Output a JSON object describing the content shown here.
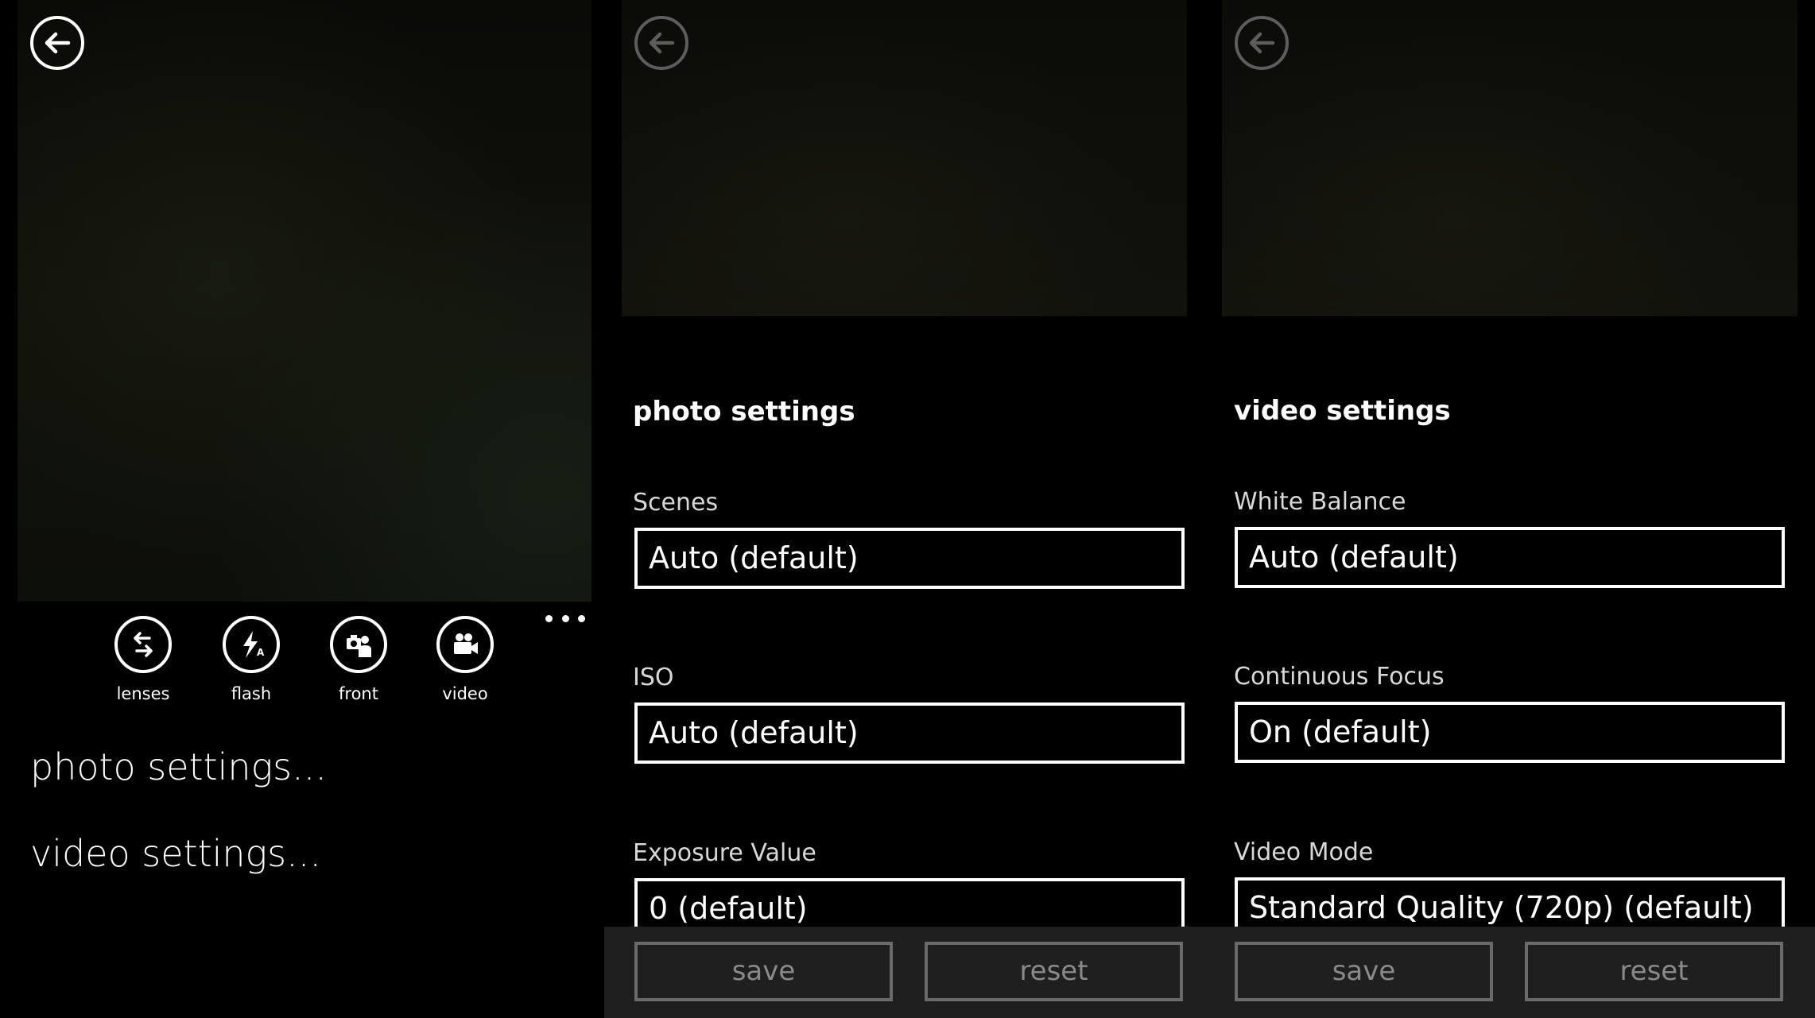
{
  "camera": {
    "buttons": [
      {
        "label": "lenses",
        "icon": "lenses-icon"
      },
      {
        "label": "flash",
        "icon": "flash-auto-icon"
      },
      {
        "label": "front",
        "icon": "front-camera-icon"
      },
      {
        "label": "video",
        "icon": "video-camera-icon"
      }
    ],
    "menu": [
      "photo settings...",
      "video settings..."
    ]
  },
  "photo": {
    "title": "photo settings",
    "fields": [
      {
        "label": "Scenes",
        "value": "Auto (default)"
      },
      {
        "label": "ISO",
        "value": "Auto (default)"
      },
      {
        "label": "Exposure Value",
        "value": "0 (default)"
      }
    ],
    "save": "save",
    "reset": "reset"
  },
  "video": {
    "title": "video settings",
    "fields": [
      {
        "label": "White Balance",
        "value": "Auto (default)"
      },
      {
        "label": "Continuous Focus",
        "value": "On (default)"
      },
      {
        "label": "Video Mode",
        "value": "Standard Quality (720p) (default)"
      }
    ],
    "save": "save",
    "reset": "reset"
  }
}
